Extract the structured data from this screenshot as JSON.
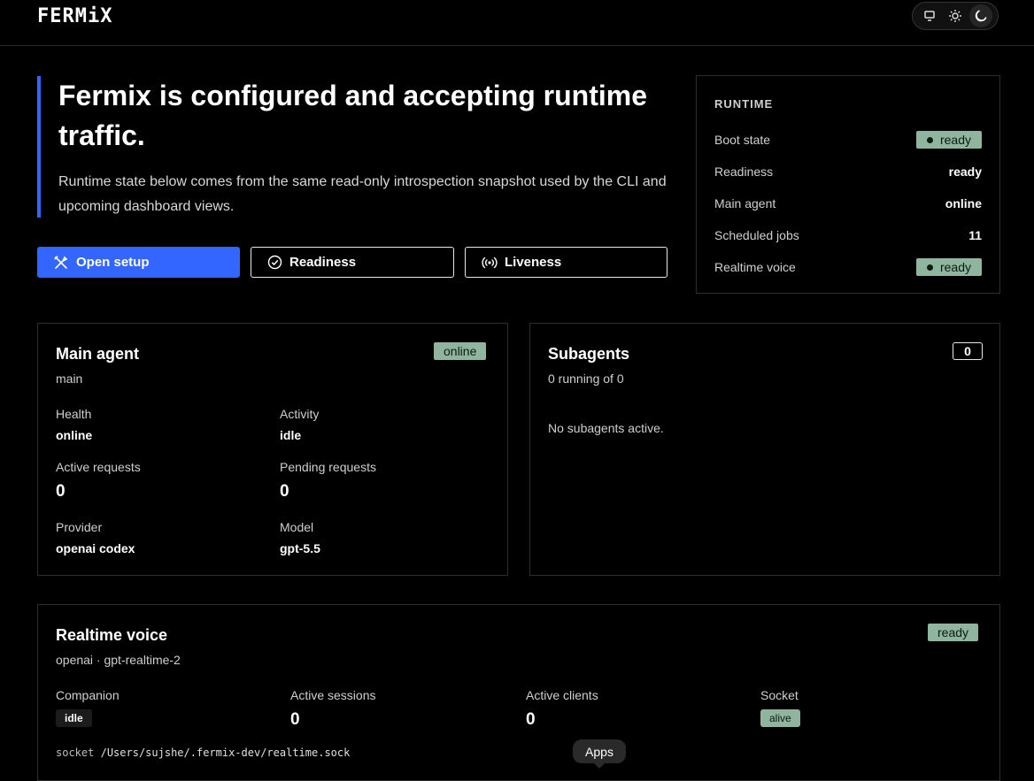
{
  "brand": {
    "logo": "FERMiX"
  },
  "theme": {
    "options": [
      "system",
      "light",
      "dark"
    ],
    "selected": "dark"
  },
  "hero": {
    "title": "Fermix is configured and accepting runtime traffic.",
    "description": "Runtime state below comes from the same read-only introspection snapshot used by the CLI and upcoming dashboard views."
  },
  "actions": {
    "open_setup": "Open setup",
    "readiness": "Readiness",
    "liveness": "Liveness"
  },
  "runtime": {
    "title": "RUNTIME",
    "rows": [
      {
        "label": "Boot state",
        "value": "ready",
        "style": "pill"
      },
      {
        "label": "Readiness",
        "value": "ready",
        "style": "text"
      },
      {
        "label": "Main agent",
        "value": "online",
        "style": "text"
      },
      {
        "label": "Scheduled jobs",
        "value": "11",
        "style": "text"
      },
      {
        "label": "Realtime voice",
        "value": "ready",
        "style": "pill"
      }
    ]
  },
  "main_agent": {
    "title": "Main agent",
    "subtitle": "main",
    "status": "online",
    "health_label": "Health",
    "health_value": "online",
    "activity_label": "Activity",
    "activity_value": "idle",
    "active_requests_label": "Active requests",
    "active_requests_value": "0",
    "pending_requests_label": "Pending requests",
    "pending_requests_value": "0",
    "provider_label": "Provider",
    "provider_value": "openai codex",
    "model_label": "Model",
    "model_value": "gpt-5.5"
  },
  "subagents": {
    "title": "Subagents",
    "subtitle": "0 running of 0",
    "count": "0",
    "empty": "No subagents active."
  },
  "realtime_voice": {
    "title": "Realtime voice",
    "subtitle": "openai · gpt-realtime-2",
    "status": "ready",
    "companion_label": "Companion",
    "companion_value": "idle",
    "sessions_label": "Active sessions",
    "sessions_value": "0",
    "clients_label": "Active clients",
    "clients_value": "0",
    "socket_label": "Socket",
    "socket_value": "alive",
    "socket_path_label": "socket",
    "socket_path": "/Users/sujshe/.fermix-dev/realtime.sock"
  },
  "tooltip": {
    "text": "Apps"
  }
}
